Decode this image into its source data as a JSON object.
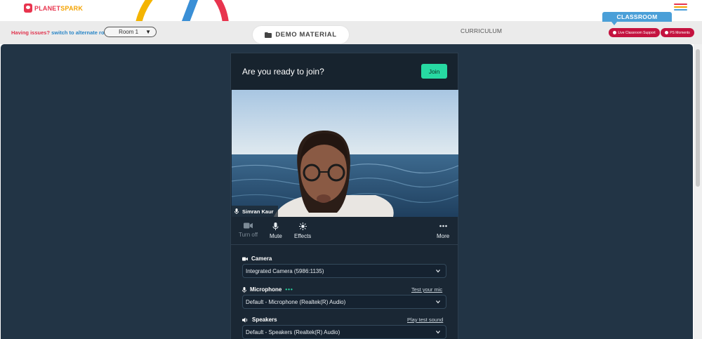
{
  "header": {
    "logo_text_planet": "PLANET",
    "logo_text_spark": "SPARK",
    "classroom_tab": "CLASSROOM"
  },
  "subbar": {
    "issues_prefix": "Having issues?",
    "issues_link": "switch to alternate room",
    "room_value": "Room 1",
    "demo_material": "DEMO MATERIAL",
    "curriculum": "CURRICULUM",
    "live_support": "Live Classroom Support",
    "ps_moments": "PS Moments"
  },
  "meet": {
    "title": "Are you ready to join?",
    "join": "Join",
    "participant_name": "Simran Kaur",
    "controls": {
      "camera": "Turn off",
      "mute": "Mute",
      "effects": "Effects",
      "more": "More"
    },
    "camera_label": "Camera",
    "camera_value": "Integrated Camera (5986:1135)",
    "microphone_label": "Microphone",
    "mic_test": "Test your mic",
    "microphone_value": "Default - Microphone (Realtek(R) Audio)",
    "speakers_label": "Speakers",
    "speaker_test": "Play test sound",
    "speakers_value": "Default - Speakers (Realtek(R) Audio)"
  },
  "colors": {
    "brand_red": "#e8344e",
    "accent_blue": "#4a9fd8",
    "join_green": "#27d9a2",
    "pill_red": "#c4123f",
    "main_bg": "#223445"
  },
  "icons": {
    "folder": "folder-icon",
    "mic": "microphone-icon",
    "camera": "video-camera-icon",
    "effects": "sparkle-icon",
    "more": "more-dots-icon",
    "speaker": "speaker-icon",
    "chevron": "chevron-down-icon",
    "menu": "hamburger-menu-icon"
  }
}
